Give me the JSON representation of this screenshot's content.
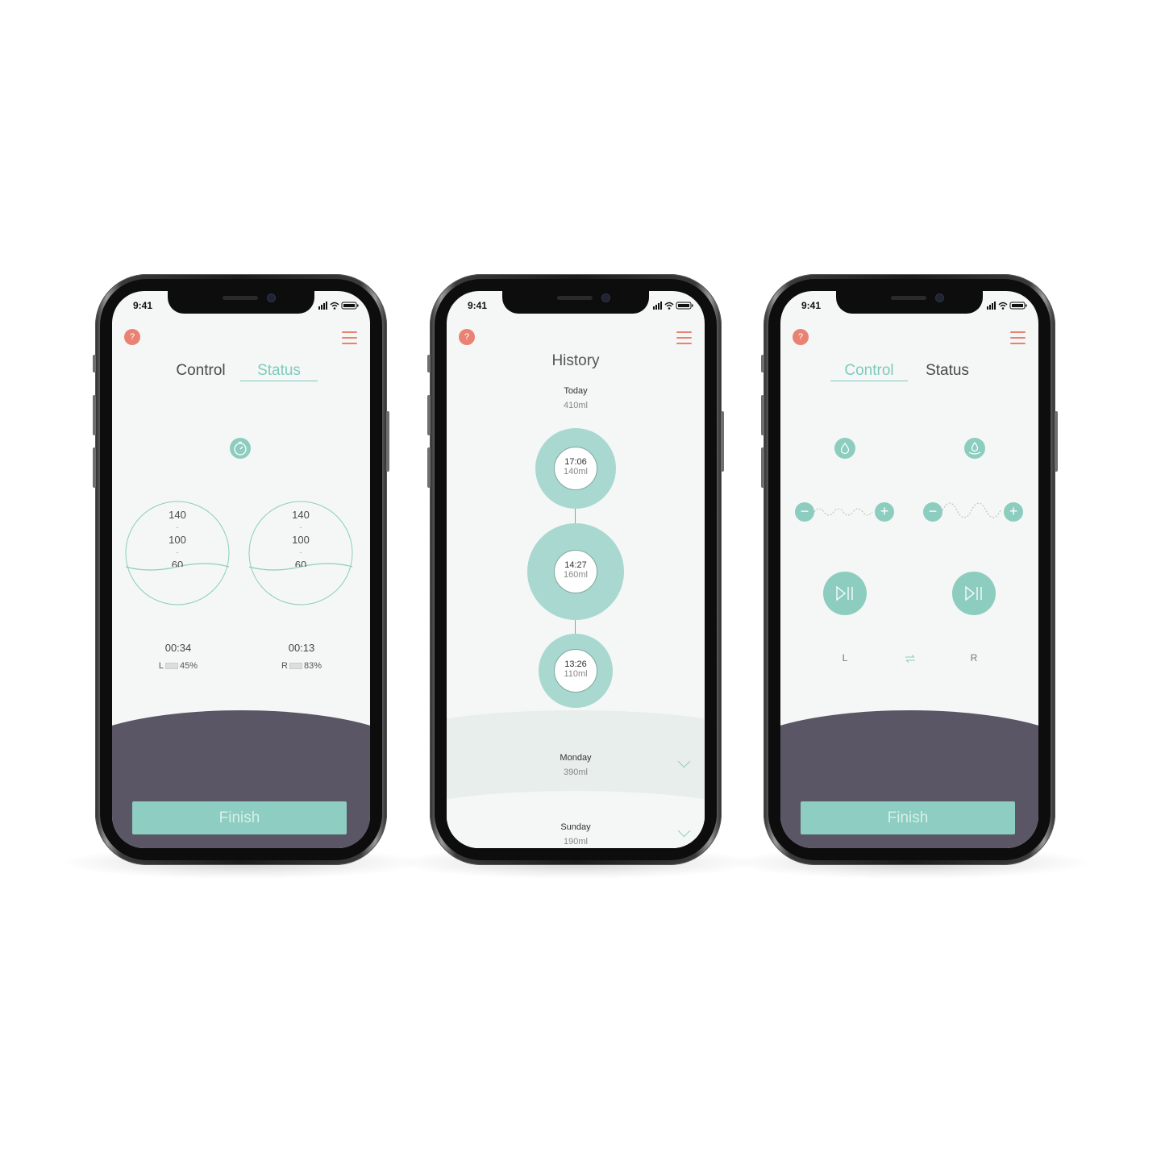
{
  "status_bar": {
    "time": "9:41"
  },
  "common": {
    "help_glyph": "?",
    "finish_label": "Finish",
    "icons": [
      "help-icon",
      "menu-icon",
      "signal-icon",
      "wifi-icon",
      "battery-icon"
    ]
  },
  "screen1": {
    "tabs": [
      {
        "label": "Control",
        "active": false
      },
      {
        "label": "Status",
        "active": true
      }
    ],
    "timer_icon": "stopwatch-icon",
    "gauges": [
      {
        "scale": [
          "140",
          "-",
          "100",
          "-",
          "60"
        ],
        "time": "00:34",
        "side": "L",
        "battery": "45%"
      },
      {
        "scale": [
          "140",
          "-",
          "100",
          "-",
          "60"
        ],
        "time": "00:13",
        "side": "R",
        "battery": "83%"
      }
    ]
  },
  "screen2": {
    "title": "History",
    "today": {
      "label": "Today",
      "amount": "410ml"
    },
    "sessions": [
      {
        "time": "17:06",
        "amount": "140ml"
      },
      {
        "time": "14:27",
        "amount": "160ml"
      },
      {
        "time": "13:26",
        "amount": "110ml"
      }
    ],
    "days": [
      {
        "label": "Monday",
        "amount": "390ml"
      },
      {
        "label": "Sunday",
        "amount": "190ml"
      }
    ]
  },
  "screen3": {
    "tabs": [
      {
        "label": "Control",
        "active": true
      },
      {
        "label": "Status",
        "active": false
      }
    ],
    "minus_glyph": "−",
    "plus_glyph": "+",
    "left_label": "L",
    "right_label": "R",
    "icons": [
      "droplet-icon",
      "droplet-wave-icon",
      "wave-icon",
      "play-pause-icon",
      "swap-icon"
    ]
  },
  "colors": {
    "mint": "#8dcdbf",
    "coral": "#e98272",
    "dark": "#5a5665",
    "screen_bg": "#f4f7f5"
  }
}
